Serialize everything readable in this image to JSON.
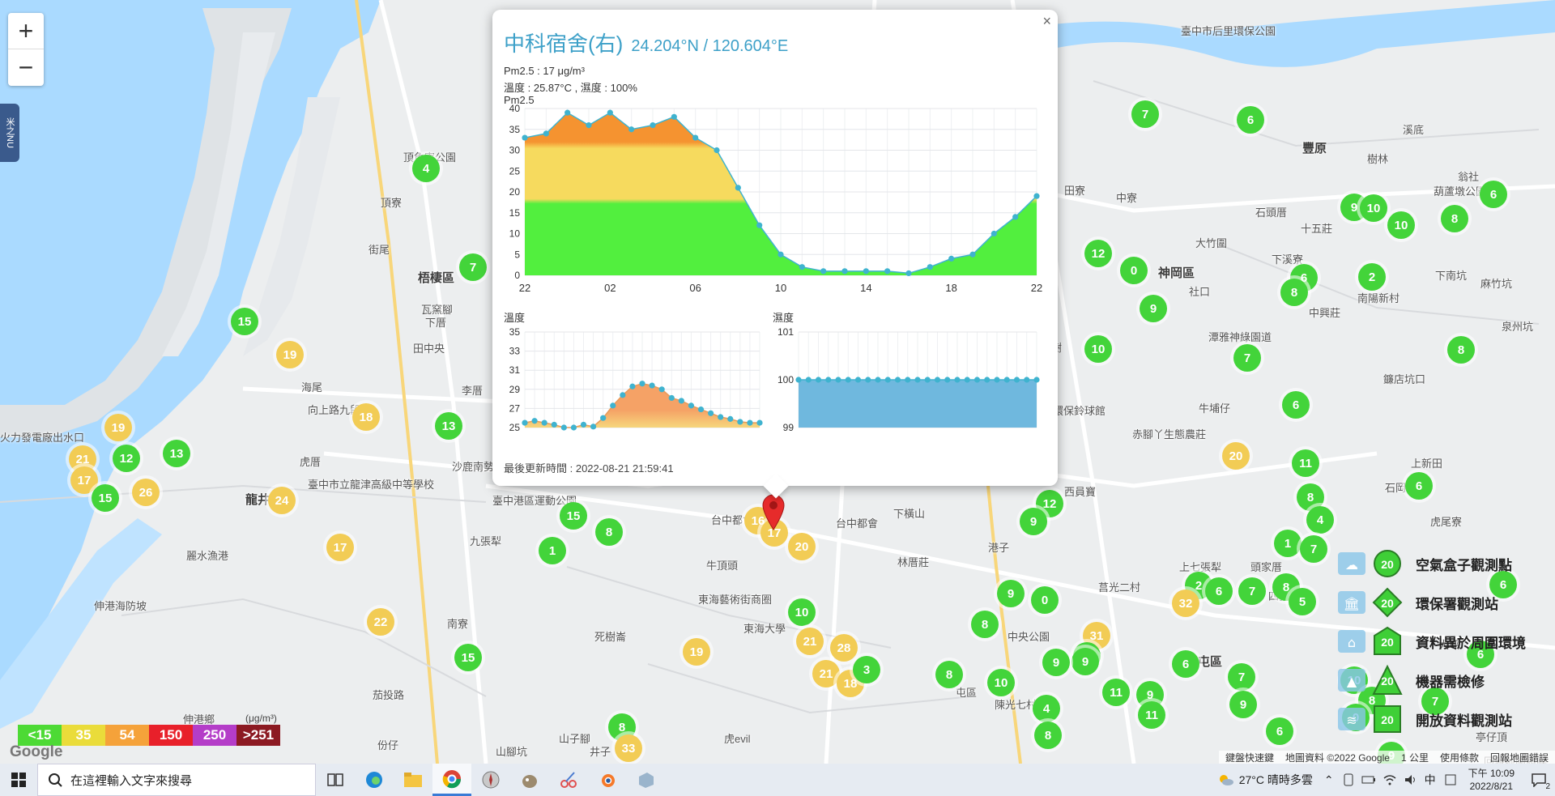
{
  "map": {
    "places": [
      {
        "t": "頂魚寮公園"
      },
      {
        "t": "頂寮"
      },
      {
        "t": "街尾"
      },
      {
        "t": "梧棲區"
      },
      {
        "t": "瓦窯腳"
      },
      {
        "t": "下厝"
      },
      {
        "t": "田中央"
      },
      {
        "t": "海尾"
      },
      {
        "t": "向上路九段"
      },
      {
        "t": "李厝"
      },
      {
        "t": "虎厝"
      },
      {
        "t": "龍井"
      },
      {
        "t": "麗水漁港"
      },
      {
        "t": "伸港海防坡"
      },
      {
        "t": "火力發電廠出水口"
      },
      {
        "t": "臺中市立龍津高級中等學校"
      },
      {
        "t": "沙鹿南勢"
      },
      {
        "t": "臺中港區運動公園"
      },
      {
        "t": "九張犁"
      },
      {
        "t": "台中都會公園"
      },
      {
        "t": "牛頂頭"
      },
      {
        "t": "東海藝術街商圈"
      },
      {
        "t": "東海大學"
      },
      {
        "t": "死樹崙"
      },
      {
        "t": "南寮"
      },
      {
        "t": "茄投路"
      },
      {
        "t": "伸港鄉"
      },
      {
        "t": "份仔"
      },
      {
        "t": "山子腳"
      },
      {
        "t": "山腳坑"
      },
      {
        "t": "井子"
      },
      {
        "t": "虎evil"
      },
      {
        "t": "下橫山"
      },
      {
        "t": "林厝莊"
      },
      {
        "t": "港子"
      },
      {
        "t": "西員寶"
      },
      {
        "t": "臺中市后里環保公園"
      },
      {
        "t": "神岡區"
      },
      {
        "t": "大竹圍"
      },
      {
        "t": "中寮"
      },
      {
        "t": "社口"
      },
      {
        "t": "下溪寮"
      },
      {
        "t": "石頭厝"
      },
      {
        "t": "十五莊"
      },
      {
        "t": "南陽新村"
      },
      {
        "t": "中興莊"
      },
      {
        "t": "豐原"
      },
      {
        "t": "鐮店坑口"
      },
      {
        "t": "泉州坑"
      },
      {
        "t": "麻竹坑"
      },
      {
        "t": "下南坑"
      },
      {
        "t": "翁社"
      },
      {
        "t": "樹林"
      },
      {
        "t": "溪底"
      },
      {
        "t": "葫蘆墩公園"
      },
      {
        "t": "潭雅神綠園道"
      },
      {
        "t": "牛埔仔"
      },
      {
        "t": "赤腳丫生態農莊"
      },
      {
        "t": "環保鈴球館"
      },
      {
        "t": "上新田"
      },
      {
        "t": "石岡公園"
      },
      {
        "t": "虎尾寮"
      },
      {
        "t": "上七張犁"
      },
      {
        "t": "中港新村"
      },
      {
        "t": "頭家厝"
      },
      {
        "t": "莒光二村"
      },
      {
        "t": "四張犁"
      },
      {
        "t": "中央公園"
      },
      {
        "t": "北屯區"
      },
      {
        "t": "屯區"
      },
      {
        "t": "陳光七村"
      },
      {
        "t": "大坪"
      },
      {
        "t": "亭仔頂"
      },
      {
        "t": "回報地圖錯誤"
      },
      {
        "t": "田寮"
      },
      {
        "t": "下楓樹"
      },
      {
        "t": "台中都會"
      }
    ],
    "markers": [
      {
        "v": "4",
        "c": "green"
      },
      {
        "v": "7",
        "c": "green"
      },
      {
        "v": "15",
        "c": "green"
      },
      {
        "v": "19",
        "c": "yellow"
      },
      {
        "v": "18",
        "c": "yellow"
      },
      {
        "v": "13",
        "c": "green"
      },
      {
        "v": "19",
        "c": "yellow"
      },
      {
        "v": "21",
        "c": "yellow"
      },
      {
        "v": "12",
        "c": "green"
      },
      {
        "v": "13",
        "c": "green"
      },
      {
        "v": "17",
        "c": "yellow"
      },
      {
        "v": "15",
        "c": "green"
      },
      {
        "v": "26",
        "c": "yellow"
      },
      {
        "v": "24",
        "c": "yellow"
      },
      {
        "v": "17",
        "c": "yellow"
      },
      {
        "v": "22",
        "c": "yellow"
      },
      {
        "v": "15",
        "c": "green"
      },
      {
        "v": "1",
        "c": "green"
      },
      {
        "v": "15",
        "c": "green"
      },
      {
        "v": "8",
        "c": "green"
      },
      {
        "v": "16",
        "c": "yellow"
      },
      {
        "v": "17",
        "c": "yellow"
      },
      {
        "v": "20",
        "c": "yellow"
      },
      {
        "v": "10",
        "c": "green"
      },
      {
        "v": "19",
        "c": "yellow"
      },
      {
        "v": "21",
        "c": "yellow"
      },
      {
        "v": "28",
        "c": "yellow"
      },
      {
        "v": "21",
        "c": "yellow"
      },
      {
        "v": "18",
        "c": "yellow"
      },
      {
        "v": "3",
        "c": "green"
      },
      {
        "v": "8",
        "c": "green"
      },
      {
        "v": "33",
        "c": "yellow"
      },
      {
        "v": "7",
        "c": "green"
      },
      {
        "v": "6",
        "c": "green"
      },
      {
        "v": "12",
        "c": "green"
      },
      {
        "v": "0",
        "c": "green"
      },
      {
        "v": "9",
        "c": "green"
      },
      {
        "v": "10",
        "c": "green"
      },
      {
        "v": "7",
        "c": "green"
      },
      {
        "v": "6",
        "c": "green"
      },
      {
        "v": "8",
        "c": "green"
      },
      {
        "v": "6",
        "c": "green"
      },
      {
        "v": "2",
        "c": "green"
      },
      {
        "v": "9",
        "c": "green"
      },
      {
        "v": "10",
        "c": "green"
      },
      {
        "v": "10",
        "c": "green"
      },
      {
        "v": "6",
        "c": "green"
      },
      {
        "v": "8",
        "c": "green"
      },
      {
        "v": "20",
        "c": "yellow"
      },
      {
        "v": "11",
        "c": "green"
      },
      {
        "v": "8",
        "c": "green"
      },
      {
        "v": "4",
        "c": "green"
      },
      {
        "v": "1",
        "c": "green"
      },
      {
        "v": "7",
        "c": "green"
      },
      {
        "v": "6",
        "c": "green"
      },
      {
        "v": "12",
        "c": "green"
      },
      {
        "v": "9",
        "c": "green"
      },
      {
        "v": "9",
        "c": "green"
      },
      {
        "v": "0",
        "c": "green"
      },
      {
        "v": "8",
        "c": "green"
      },
      {
        "v": "31",
        "c": "yellow"
      },
      {
        "v": "8",
        "c": "green"
      },
      {
        "v": "9",
        "c": "green"
      },
      {
        "v": "9",
        "c": "green"
      },
      {
        "v": "8",
        "c": "green"
      },
      {
        "v": "10",
        "c": "green"
      },
      {
        "v": "11",
        "c": "green"
      },
      {
        "v": "9",
        "c": "green"
      },
      {
        "v": "6",
        "c": "green"
      },
      {
        "v": "4",
        "c": "green"
      },
      {
        "v": "8",
        "c": "green"
      },
      {
        "v": "11",
        "c": "green"
      },
      {
        "v": "7",
        "c": "green"
      },
      {
        "v": "9",
        "c": "green"
      },
      {
        "v": "6",
        "c": "green"
      },
      {
        "v": "2",
        "c": "green"
      },
      {
        "v": "32",
        "c": "yellow"
      },
      {
        "v": "6",
        "c": "green"
      },
      {
        "v": "7",
        "c": "green"
      },
      {
        "v": "8",
        "c": "green"
      },
      {
        "v": "5",
        "c": "green"
      },
      {
        "v": "10",
        "c": "green"
      },
      {
        "v": "7",
        "c": "green"
      },
      {
        "v": "6",
        "c": "green"
      },
      {
        "v": "8",
        "c": "green"
      },
      {
        "v": "0",
        "c": "green"
      },
      {
        "v": "9",
        "c": "green"
      },
      {
        "v": "6",
        "c": "green"
      },
      {
        "v": "8",
        "c": "green"
      }
    ],
    "zoom_in": "+",
    "zoom_out": "−",
    "side_tab": "米之NU"
  },
  "popup": {
    "title": "中科宿舍(右)",
    "coord": "24.204°N / 120.604°E",
    "pm_line": "Pm2.5 : 17 μg/m³",
    "temp_line": "溫度 : 25.87°C , 濕度 : 100%",
    "pm_title": "Pm2.5",
    "temp_title": "溫度",
    "hum_title": "濕度",
    "update": "最後更新時間 : 2022-08-21 21:59:41",
    "close": "×"
  },
  "chart_data": [
    {
      "type": "area",
      "title": "Pm2.5",
      "x": [
        22,
        23,
        0,
        1,
        2,
        3,
        4,
        5,
        6,
        7,
        8,
        9,
        10,
        11,
        12,
        13,
        14,
        15,
        16,
        17,
        18,
        19,
        20,
        21,
        22
      ],
      "xticks": [
        "22",
        "02",
        "06",
        "10",
        "14",
        "18",
        "22"
      ],
      "y": [
        33,
        34,
        39,
        36,
        39,
        35,
        36,
        38,
        33,
        30,
        21,
        12,
        5,
        2,
        1,
        1,
        1,
        1,
        0.5,
        2,
        4,
        5,
        10,
        14,
        19
      ],
      "ylim": [
        0,
        40
      ],
      "yticks": [
        0,
        5,
        10,
        15,
        20,
        25,
        30,
        35,
        40
      ]
    },
    {
      "type": "area",
      "title": "溫度",
      "y": [
        25.5,
        25.7,
        25.5,
        25.3,
        25.0,
        25.0,
        25.3,
        25.1,
        26.0,
        27.3,
        28.4,
        29.3,
        29.6,
        29.4,
        29.0,
        28.1,
        27.8,
        27.3,
        26.9,
        26.5,
        26.1,
        25.9,
        25.6,
        25.5,
        25.5
      ],
      "ylim": [
        25,
        35
      ],
      "yticks": [
        25,
        27,
        29,
        31,
        33,
        35
      ]
    },
    {
      "type": "area",
      "title": "濕度",
      "y": [
        100,
        100,
        100,
        100,
        100,
        100,
        100,
        100,
        100,
        100,
        100,
        100,
        100,
        100,
        100,
        100,
        100,
        100,
        100,
        100,
        100,
        100,
        100,
        100,
        100
      ],
      "ylim": [
        99,
        101
      ],
      "yticks": [
        99,
        100,
        101
      ]
    }
  ],
  "legend": {
    "items": [
      {
        "label": "空氣盒子觀測點",
        "value": "20",
        "shape": "circle"
      },
      {
        "label": "環保署觀測站",
        "value": "20",
        "shape": "diamond"
      },
      {
        "label": "資料異於周圍環境",
        "value": "20",
        "shape": "pentagon"
      },
      {
        "label": "機器需檢修",
        "value": "20",
        "shape": "triangle"
      },
      {
        "label": "開放資料觀測站",
        "value": "20",
        "shape": "square"
      }
    ]
  },
  "aqi_scale": {
    "unit": "(μg/m³)",
    "bins": [
      {
        "label": "<15",
        "color": "#4dda35"
      },
      {
        "label": "35",
        "color": "#eadc3a"
      },
      {
        "label": "54",
        "color": "#f5a23a"
      },
      {
        "label": "150",
        "color": "#e8202a"
      },
      {
        "label": "250",
        "color": "#b43dc8"
      },
      {
        "label": ">251",
        "color": "#8c1a22"
      }
    ]
  },
  "footer": {
    "google": "Google",
    "shortcuts": "鍵盤快速鍵",
    "map_data": "地圖資料 ©2022 Google",
    "scale": "1 公里",
    "terms": "使用條款",
    "report": "回報地圖錯誤"
  },
  "taskbar": {
    "search_placeholder": "在這裡輸入文字來搜尋",
    "weather": "27°C  晴時多雲",
    "ime": "中",
    "time": "下午 10:09",
    "date": "2022/8/21",
    "notif_count": "2"
  }
}
